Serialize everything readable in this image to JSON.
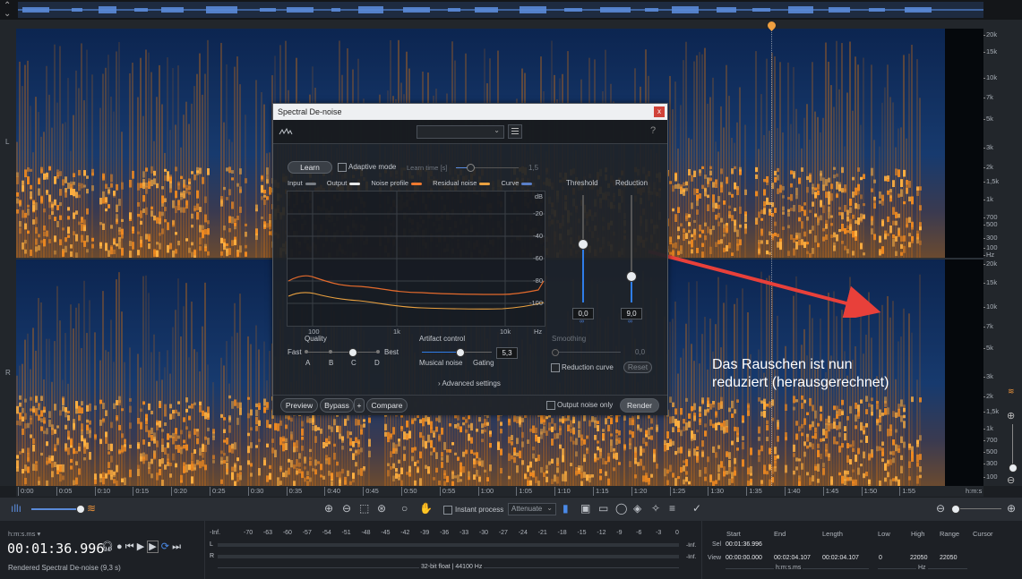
{
  "channels": {
    "left": "L",
    "right": "R"
  },
  "freq_scale": {
    "top": [
      "20k",
      "15k",
      "10k",
      "7k",
      "5k",
      "3k",
      "2k",
      "1,5k",
      "1k",
      "700",
      "500",
      "300",
      "100",
      "Hz"
    ],
    "bottom": [
      "20k",
      "15k",
      "10k",
      "7k",
      "5k",
      "3k",
      "2k",
      "1,5k",
      "1k",
      "700",
      "500",
      "300",
      "100"
    ]
  },
  "time_ruler": [
    "0:00",
    "0:05",
    "0:10",
    "0:15",
    "0:20",
    "0:25",
    "0:30",
    "0:35",
    "0:40",
    "0:45",
    "0:50",
    "0:55",
    "1:00",
    "1:05",
    "1:10",
    "1:15",
    "1:20",
    "1:25",
    "1:30",
    "1:35",
    "1:40",
    "1:45",
    "1:50",
    "1:55",
    "h:m:s"
  ],
  "annotation": {
    "line1": "Das Rauschen ist nun",
    "line2": "reduziert (herausgerechnet)"
  },
  "dialog": {
    "title": "Spectral De-noise",
    "close": "x",
    "help": "?",
    "learn": "Learn",
    "adaptive_mode": "Adaptive mode",
    "learn_time_label": "Learn time [s]",
    "learn_time_value": "1,5",
    "legend": {
      "input": "Input",
      "output": "Output",
      "noise_profile": "Noise profile",
      "residual_noise": "Residual noise",
      "curve": "Curve"
    },
    "colors": {
      "input": "#7a7f86",
      "output": "#e6e8ea",
      "noise_profile": "#f07a30",
      "residual_noise": "#e8a040",
      "curve": "#5a7fc8"
    },
    "db_labels": [
      "dB",
      "-20",
      "-40",
      "-60",
      "-80",
      "-100"
    ],
    "freq_labels": [
      "100",
      "1k",
      "10k",
      "Hz"
    ],
    "threshold_label": "Threshold",
    "threshold_value": "0,0",
    "threshold_level": 0.55,
    "reduction_label": "Reduction",
    "reduction_value": "9,0",
    "reduction_level": 0.25,
    "quality_label": "Quality",
    "quality_fast": "Fast",
    "quality_best": "Best",
    "quality_steps": [
      "A",
      "B",
      "C",
      "D"
    ],
    "quality_selected": "C",
    "artifact_label": "Artifact control",
    "artifact_value": "5,3",
    "artifact_left": "Musical noise",
    "artifact_right": "Gating",
    "smoothing_label": "Smoothing",
    "smoothing_value": "0,0",
    "reduction_curve": "Reduction curve",
    "reset": "Reset",
    "advanced": "Advanced settings",
    "preview": "Preview",
    "bypass": "Bypass",
    "plus": "+",
    "compare": "Compare",
    "output_noise_only": "Output noise only",
    "render": "Render"
  },
  "toolbar": {
    "instant_process": "Instant process",
    "attenuate": "Attenuate"
  },
  "transport": {
    "format": "h:m:s.ms",
    "time": "00:01:36.996",
    "status": "Rendered Spectral De-noise (9,3 s)"
  },
  "meter": {
    "scale": [
      "-Inf.",
      "-70",
      "-63",
      "-60",
      "-57",
      "-54",
      "-51",
      "-48",
      "-45",
      "-42",
      "-39",
      "-36",
      "-33",
      "-30",
      "-27",
      "-24",
      "-21",
      "-18",
      "-15",
      "-12",
      "-9",
      "-6",
      "-3",
      "0"
    ],
    "l": "L",
    "r": "R",
    "inf_l": "-Inf.",
    "inf_r": "-Inf.",
    "info": "32-bit float | 44100 Hz"
  },
  "selection": {
    "headers": [
      "Start",
      "End",
      "Length",
      "Low",
      "High",
      "Range",
      "Cursor"
    ],
    "sel_label": "Sel",
    "sel_start": "00:01:36.996",
    "view_label": "View",
    "view_start": "00:00:00.000",
    "view_end": "00:02:04.107",
    "view_length": "00:02:04.107",
    "low": "0",
    "high": "22050",
    "range": "22050",
    "time_unit": "h:m:s.ms",
    "freq_unit": "Hz"
  }
}
